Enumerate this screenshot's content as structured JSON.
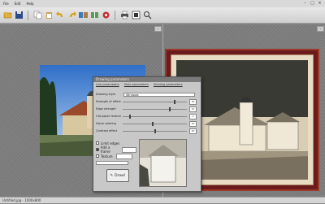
{
  "menu": {
    "items": [
      "File",
      "Edit",
      "Help"
    ]
  },
  "toolbar": {
    "icons": [
      "open-icon",
      "save-icon",
      "copy-icon",
      "paste-icon",
      "undo-icon",
      "redo-icon",
      "before-after-icon",
      "compare-icon",
      "settings-icon",
      "print-icon",
      "fit-icon",
      "zoom-icon"
    ]
  },
  "dialog": {
    "title": "Drawing parameters",
    "tabs": [
      "Line parameters",
      "Style parameters",
      "Shading parameters"
    ],
    "drawing_style_label": "Drawing style",
    "drawing_style_value": "Windows",
    "sliders": [
      {
        "label": "Strength of effect",
        "value": "10",
        "level": 0.8
      },
      {
        "label": "Edge strength",
        "value": "11",
        "level": 0.72
      },
      {
        "label": "Old paper texture",
        "value": "1",
        "level": 0.1
      },
      {
        "label": "Sepia coloring",
        "value": "10",
        "level": 0.45
      },
      {
        "label": "Contrast effect",
        "value": "10",
        "level": 0.5
      }
    ],
    "checkboxes": [
      {
        "label": "Limit edges",
        "checked": false
      },
      {
        "label": "Add a frame",
        "checked": true
      },
      {
        "label": "Texture",
        "checked": false
      }
    ],
    "draw_button": "Draw!"
  },
  "status": {
    "text": "Untitled.jpg - 1000x800"
  }
}
